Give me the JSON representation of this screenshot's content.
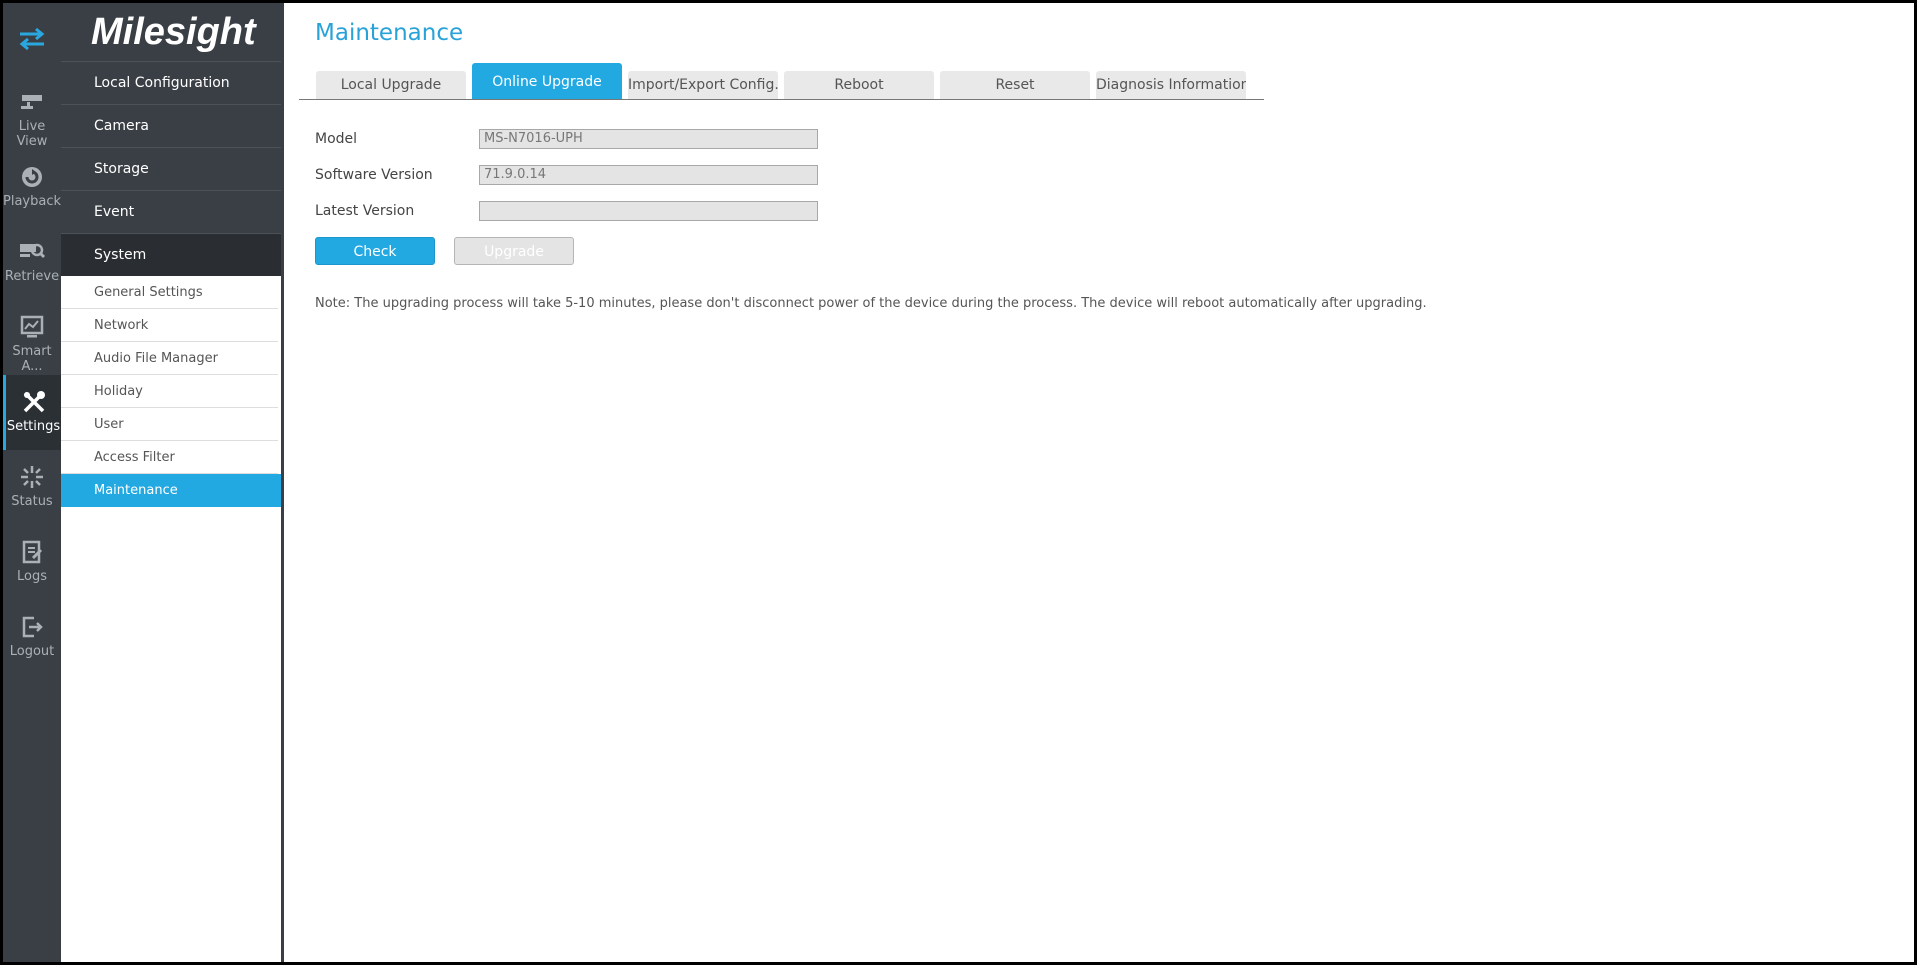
{
  "brand": {
    "logo_text": "Milesight"
  },
  "rail": {
    "items": [
      {
        "label": "Live View",
        "icon": "live-view-icon"
      },
      {
        "label": "Playback",
        "icon": "playback-icon"
      },
      {
        "label": "Retrieve",
        "icon": "retrieve-icon"
      },
      {
        "label": "Smart A...",
        "icon": "smart-analytics-icon"
      },
      {
        "label": "Settings",
        "icon": "settings-icon",
        "active": true
      },
      {
        "label": "Status",
        "icon": "status-icon"
      },
      {
        "label": "Logs",
        "icon": "logs-icon"
      },
      {
        "label": "Logout",
        "icon": "logout-icon"
      }
    ]
  },
  "menu": {
    "main": [
      "Local Configuration",
      "Camera",
      "Storage",
      "Event",
      "System"
    ],
    "sub": [
      "General Settings",
      "Network",
      "Audio File Manager",
      "Holiday",
      "User",
      "Access Filter",
      "Maintenance"
    ],
    "selected_sub": "Maintenance"
  },
  "page": {
    "title": "Maintenance",
    "tabs": [
      "Local Upgrade",
      "Online Upgrade",
      "Import/Export Config...",
      "Reboot",
      "Reset",
      "Diagnosis Information"
    ],
    "active_tab": "Online Upgrade"
  },
  "form": {
    "model_label": "Model",
    "model_value": "MS-N7016-UPH",
    "software_label": "Software Version",
    "software_value": "71.9.0.14",
    "latest_label": "Latest Version",
    "latest_value": "",
    "check_button": "Check",
    "upgrade_button": "Upgrade"
  },
  "note": "Note: The upgrading process will take 5-10 minutes, please don't disconnect power of the device during the process. The device will reboot automatically after upgrading.",
  "colors": {
    "accent": "#23a9e1",
    "rail_bg": "#3a3f45",
    "title": "#29a2d8"
  }
}
